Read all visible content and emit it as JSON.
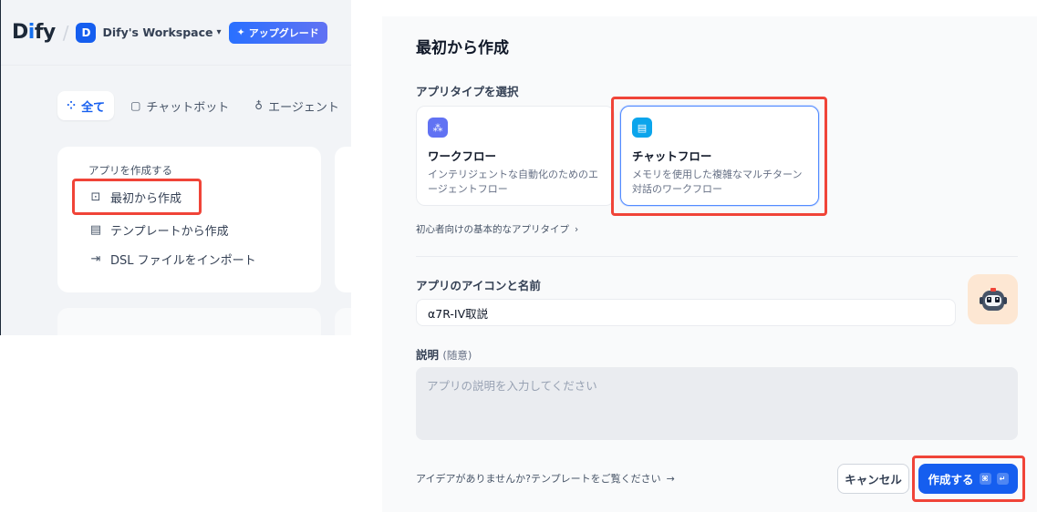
{
  "topbar": {
    "logo_prefix": "D",
    "logo_i": "i",
    "logo_suffix": "fy",
    "workspace_initial": "D",
    "workspace_name": "Dify's Workspace",
    "upgrade_label": "アップグレード"
  },
  "tabs": [
    {
      "label": "全て",
      "icon": "grid-icon",
      "active": true
    },
    {
      "label": "チャットボット",
      "icon": "chat-icon"
    },
    {
      "label": "エージェント",
      "icon": "agent-icon"
    }
  ],
  "create_card": {
    "title": "アプリを作成する",
    "items": [
      {
        "label": "最初から作成",
        "icon": "new-file-icon"
      },
      {
        "label": "テンプレートから作成",
        "icon": "template-icon"
      },
      {
        "label": "DSL ファイルをインポート",
        "icon": "import-icon"
      }
    ]
  },
  "modal": {
    "title": "最初から作成",
    "app_type_label": "アプリタイプを選択",
    "types": [
      {
        "name": "ワークフロー",
        "desc": "インテリジェントな自動化のためのエージェントフロー",
        "icon": "workflow-icon",
        "color": "#6172f3"
      },
      {
        "name": "チャットフロー",
        "desc": "メモリを使用した複雑なマルチターン対話のワークフロー",
        "icon": "chatflow-icon",
        "color": "#0ba5ec",
        "selected": true
      }
    ],
    "basic_link": "初心者向けの基本的なアプリタイプ",
    "name_label": "アプリのアイコンと名前",
    "name_value": "α7R-IV取説",
    "app_icon": "robot-icon",
    "desc_label": "説明",
    "desc_optional": "(随意)",
    "desc_placeholder": "アプリの説明を入力してください",
    "idea_link": "アイデアがありませんか?テンプレートをご覧ください",
    "cancel_label": "キャンセル",
    "create_label": "作成する",
    "shortcut_cmd": "⌘",
    "shortcut_enter": "↵"
  },
  "colors": {
    "accent": "#155eef",
    "highlight": "#f04438"
  }
}
